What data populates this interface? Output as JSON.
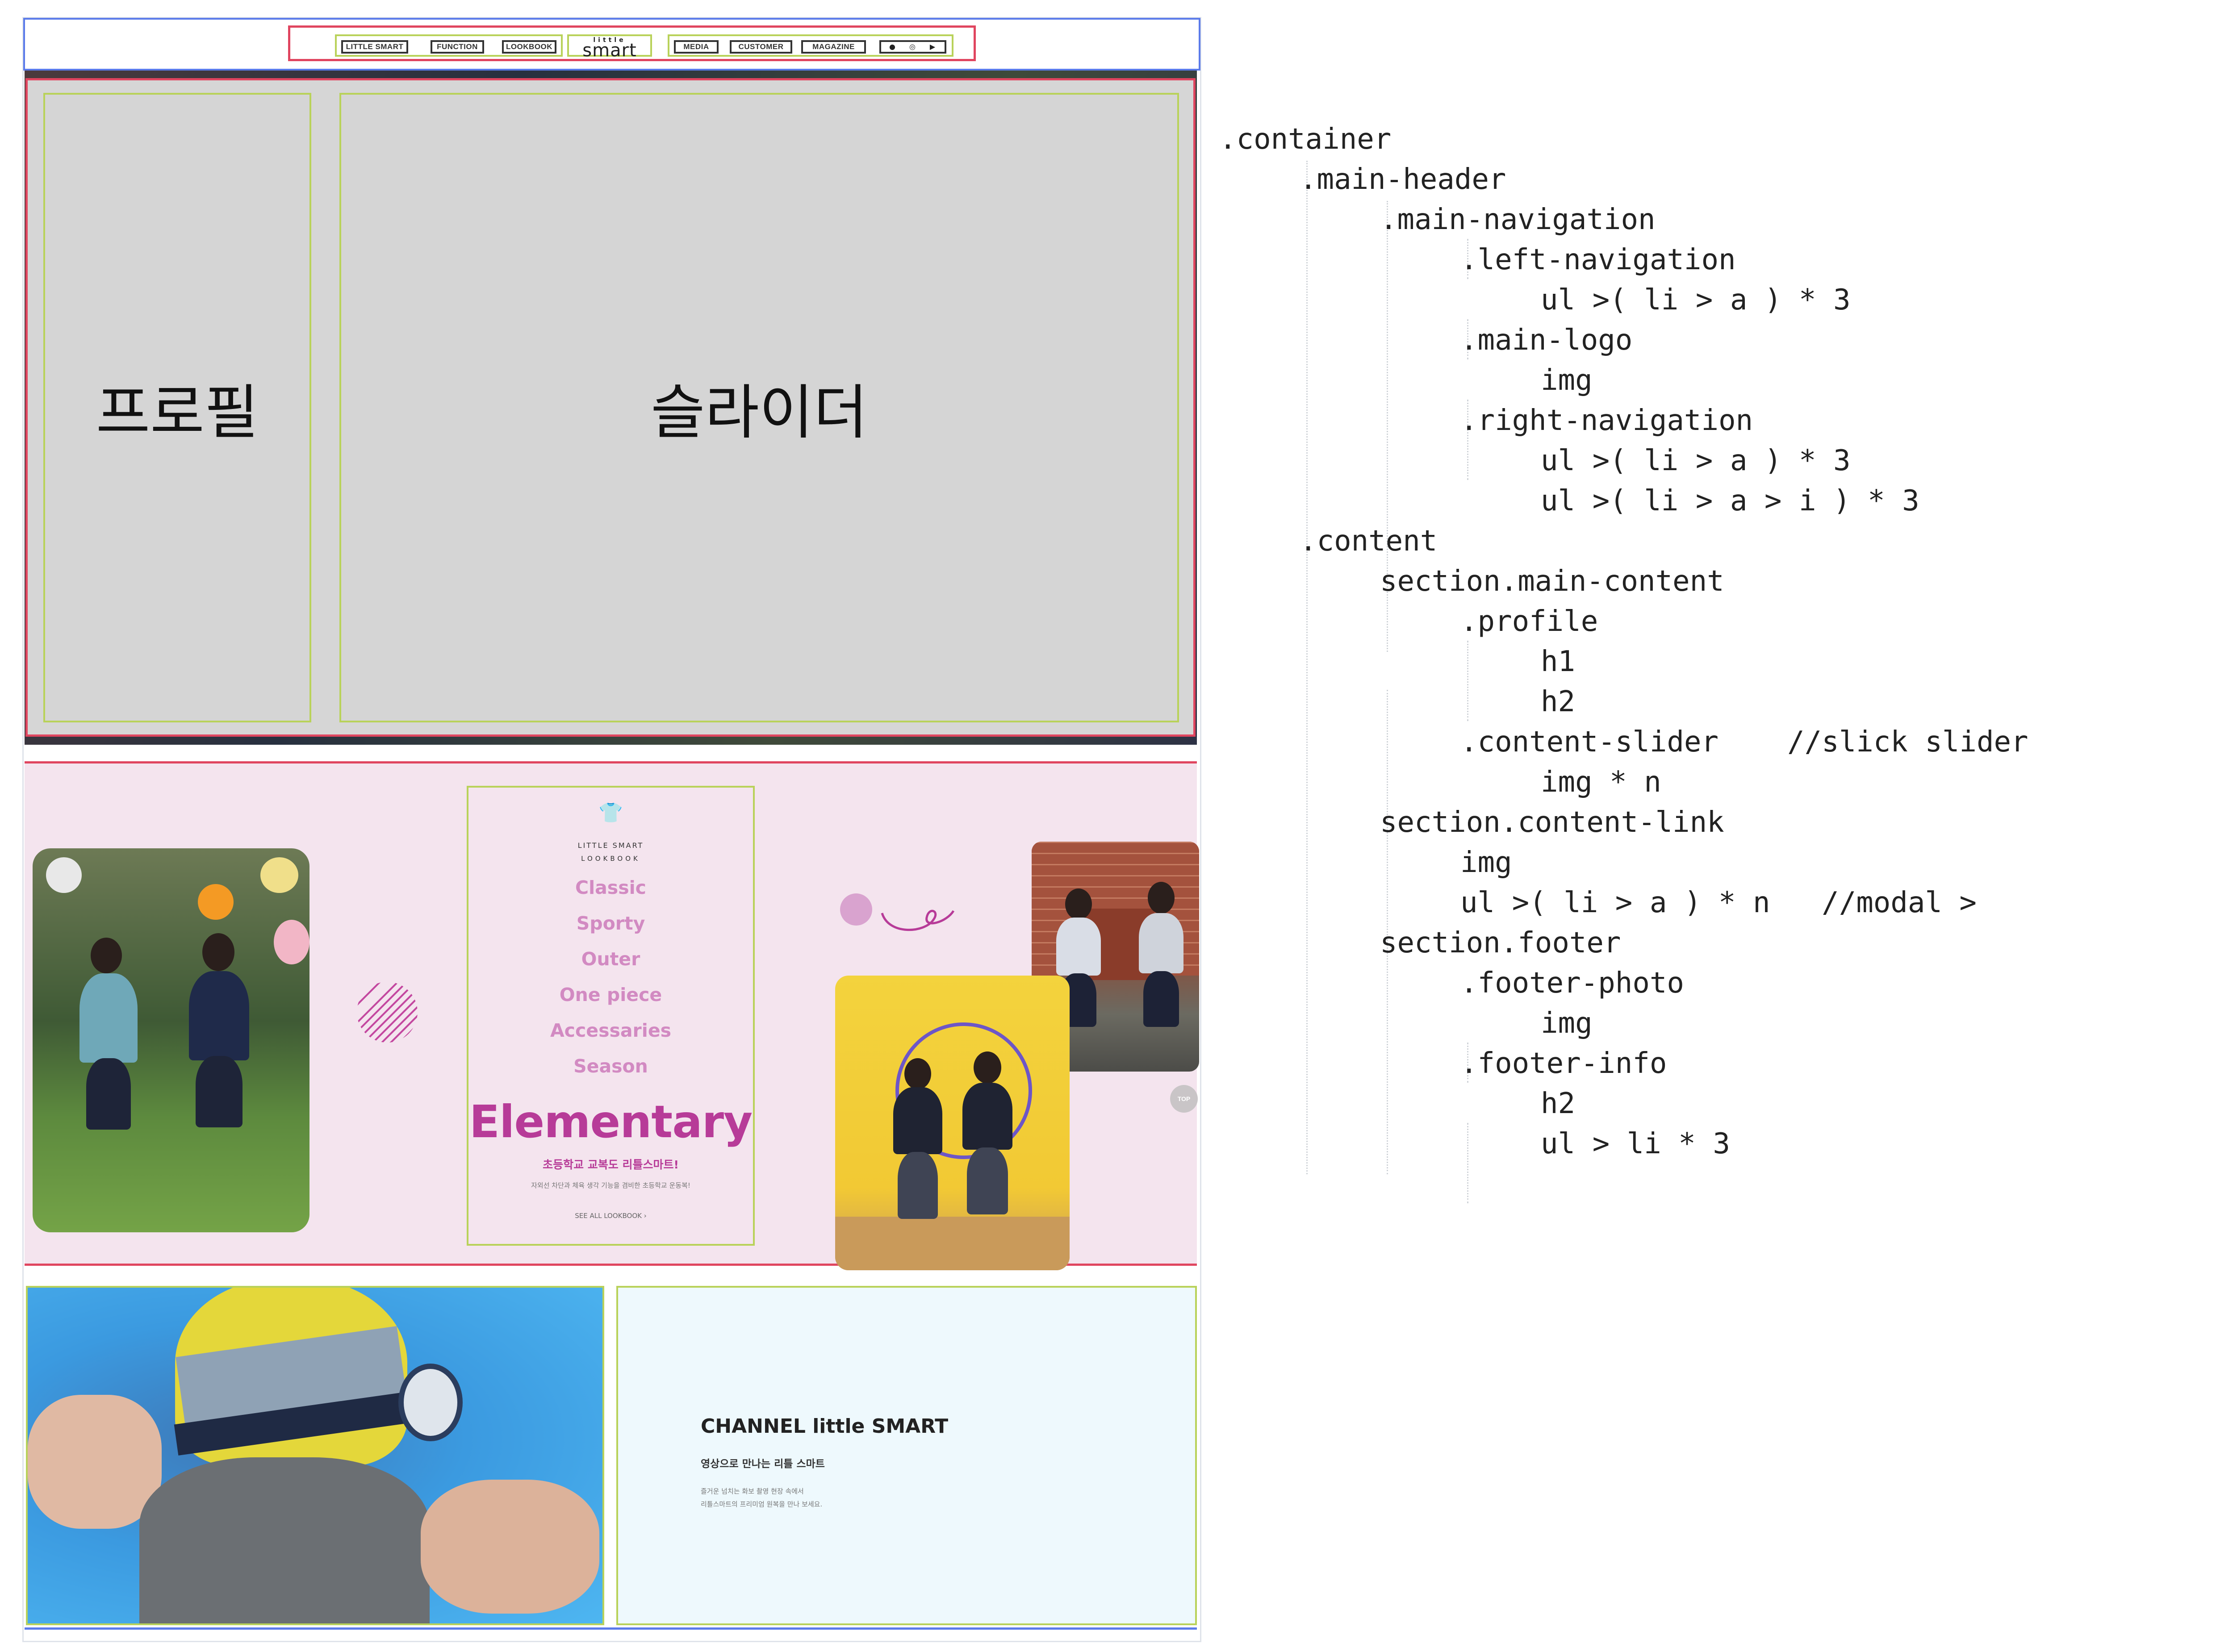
{
  "nav": {
    "left": [
      "LITTLE SMART",
      "FUNCTION",
      "LOOKBOOK"
    ],
    "logo_small": "little",
    "logo_main": "smart",
    "right": [
      "MEDIA",
      "CUSTOMER",
      "MAGAZINE"
    ],
    "social_icons": [
      "facebook-icon",
      "instagram-icon",
      "youtube-icon"
    ]
  },
  "hero": {
    "profile_label": "프로필",
    "slider_label": "슬라이더"
  },
  "lookbook": {
    "brand": "LITTLE SMART",
    "sub": "LOOKBOOK",
    "items": [
      "Classic",
      "Sporty",
      "Outer",
      "One piece",
      "Accessaries",
      "Season"
    ],
    "title": "Elementary",
    "kr_heading": "초등학교 교복도 리틀스마트!",
    "kr_desc": "자외선 차단과 체육 생각 기능을 겸비한 초등학교 운동복!",
    "link": "SEE ALL LOOKBOOK"
  },
  "top_button": "TOP",
  "footer": {
    "title": "CHANNEL little SMART",
    "subtitle": "영상으로 만나는 리틀 스마트",
    "line1": "즐거운 넘치는 화보 촬영 현장 속에서",
    "line2": "리틀스마트의 프리미엄 원복을 만나 보세요."
  },
  "code_lines": [
    ".container",
    ".main-header",
    ".main-navigation",
    ".left-navigation",
    "ul >( li > a ) * 3",
    ".main-logo",
    "img",
    ".right-navigation",
    "ul >( li > a ) * 3",
    "ul >( li > a > i ) * 3",
    ".content",
    "section.main-content",
    ".profile",
    "h1",
    "h2",
    ".content-slider    //slick slider",
    "img * n",
    "section.content-link",
    "img",
    "ul >( li > a ) * n   //modal >",
    "section.footer",
    ".footer-photo",
    "img",
    ".footer-info",
    "h2",
    "ul > li * 3"
  ],
  "colors": {
    "wire_blue": "#5b7bea",
    "wire_red": "#e0455f",
    "wire_green": "#b9d25a",
    "lookbook_pink": "#b73b98",
    "section_pink": "#f4e4ee"
  }
}
